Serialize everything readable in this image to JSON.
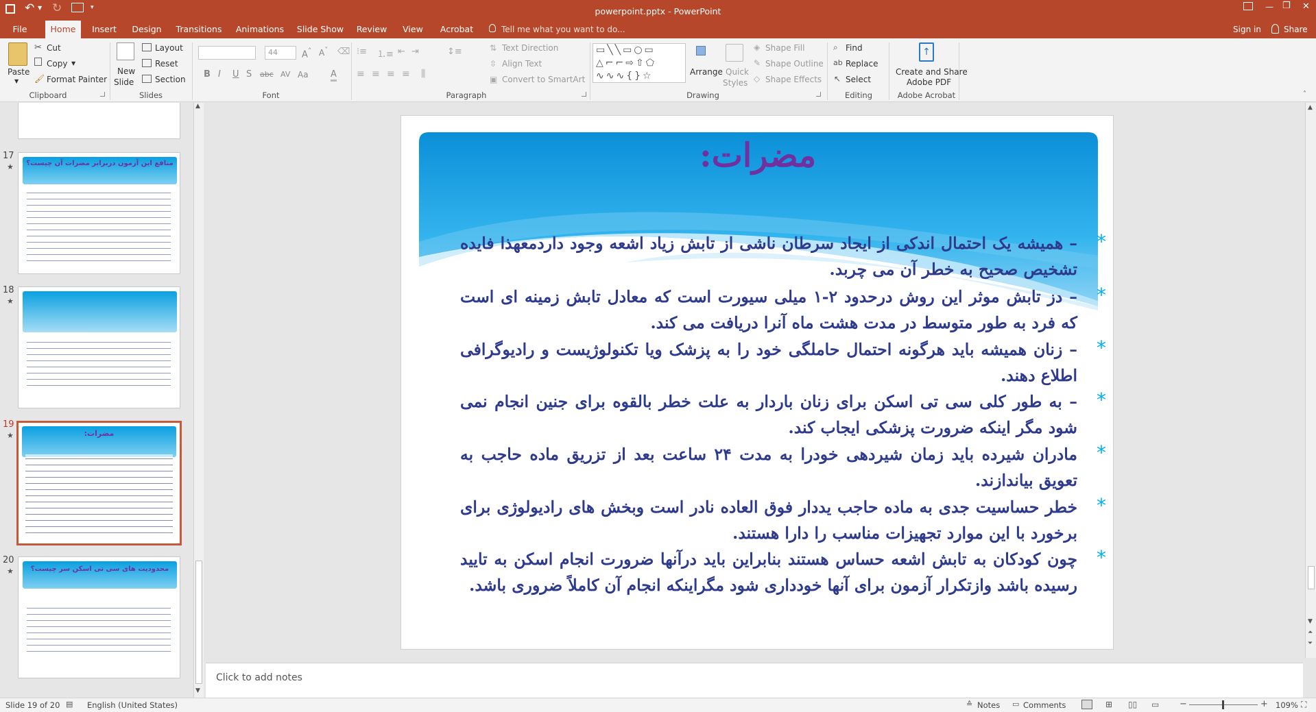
{
  "window": {
    "title": "powerpoint.pptx - PowerPoint",
    "controls": {
      "minimize": "—",
      "restore": "❐",
      "close": "✕"
    }
  },
  "tabs": [
    {
      "label": "File"
    },
    {
      "label": "Home"
    },
    {
      "label": "Insert"
    },
    {
      "label": "Design"
    },
    {
      "label": "Transitions"
    },
    {
      "label": "Animations"
    },
    {
      "label": "Slide Show"
    },
    {
      "label": "Review"
    },
    {
      "label": "View"
    },
    {
      "label": "Acrobat"
    }
  ],
  "tell_me": "Tell me what you want to do...",
  "sign_in": "Sign in",
  "share": "Share",
  "ribbon": {
    "clipboard": {
      "paste": "Paste",
      "cut": "Cut",
      "copy": "Copy",
      "format_painter": "Format Painter",
      "label": "Clipboard"
    },
    "slides": {
      "new_slide_1": "New",
      "new_slide_2": "Slide",
      "layout": "Layout",
      "reset": "Reset",
      "section": "Section",
      "label": "Slides"
    },
    "font": {
      "font_name": "",
      "font_size": "44",
      "label": "Font"
    },
    "paragraph": {
      "text_direction": "Text Direction",
      "align_text": "Align Text",
      "convert_smartart": "Convert to SmartArt",
      "label": "Paragraph"
    },
    "drawing": {
      "arrange": "Arrange",
      "quick_styles_1": "Quick",
      "quick_styles_2": "Styles",
      "shape_fill": "Shape Fill",
      "shape_outline": "Shape Outline",
      "shape_effects": "Shape Effects",
      "label": "Drawing"
    },
    "editing": {
      "find": "Find",
      "replace": "Replace",
      "select": "Select",
      "label": "Editing"
    },
    "acrobat": {
      "create_1": "Create and Share",
      "create_2": "Adobe PDF",
      "label": "Adobe Acrobat"
    }
  },
  "thumbnails": [
    {
      "num": "17",
      "title": "منافع این آزمون دربرابر مضرات آن چیست؟",
      "selected": false
    },
    {
      "num": "18",
      "title": "",
      "selected": false
    },
    {
      "num": "19",
      "title": "مضرات:",
      "selected": true
    },
    {
      "num": "20",
      "title": "محدودیت های سی تی اسکن سر چیست؟",
      "selected": false
    }
  ],
  "slide": {
    "title": "مضرات:",
    "bullets": [
      "–     همیشه یک احتمال اندکی از ایجاد سرطان ناشی از تابش زیاد اشعه وجود داردمعهذا فایده تشخیص صحیح به خطر آن می چربد.",
      "–     دز تابش موثر این روش درحدود ۲-۱ میلی سیورت است که معادل تابش زمینه ای است که فرد به طور متوسط در مدت هشت ماه آنرا دریافت می کند.",
      "–     زنان همیشه باید هرگونه احتمال حاملگی خود را به پزشک ویا تکنولوژیست و رادیوگرافی اطلاع دهند.",
      "–     به طور کلی سی تی اسکن برای زنان باردار به علت خطر بالقوه برای جنین انجام نمی شود مگر اینکه ضرورت پزشکی ایجاب کند.",
      "مادران شیرده باید زمان شیردهی خودرا به مدت ۲۴ ساعت بعد از تزریق ماده حاجب به تعویق بیاندازند.",
      "خطر حساسیت جدی به ماده حاجب یددار فوق العاده نادر است وبخش های رادیولوژی برای برخورد با این موارد تجهیزات مناسب را دارا هستند.",
      "چون کودکان به تابش اشعه حساس هستند بنابراین باید درآنها ضرورت انجام اسکن به تایید رسیده باشد وازتکرار آزمون برای آنها خودداری شود مگراینکه انجام آن کاملاً ضروری باشد."
    ]
  },
  "notes_placeholder": "Click to add notes",
  "status": {
    "slide_info": "Slide 19 of 20",
    "language": "English (United States)",
    "notes": "Notes",
    "comments": "Comments",
    "zoom": "109%"
  },
  "colors": {
    "accent": "#b7472a",
    "title_purple": "#7030a0",
    "body_navy": "#2e3a8c",
    "bullet_cyan": "#00b0f0"
  }
}
